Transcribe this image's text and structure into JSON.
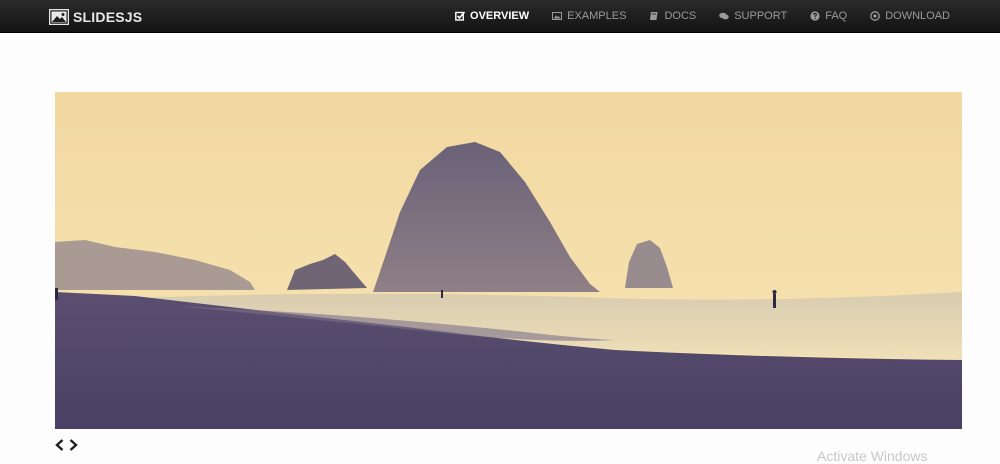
{
  "brand": {
    "name": "SLIDESJS",
    "icon": "image-icon"
  },
  "nav": {
    "items": [
      {
        "label": "OVERVIEW",
        "icon": "check-square-icon",
        "active": true
      },
      {
        "label": "EXAMPLES",
        "icon": "picture-icon",
        "active": false
      },
      {
        "label": "DOCS",
        "icon": "book-icon",
        "active": false
      },
      {
        "label": "SUPPORT",
        "icon": "comments-icon",
        "active": false
      },
      {
        "label": "FAQ",
        "icon": "question-circle-icon",
        "active": false
      },
      {
        "label": "DOWNLOAD",
        "icon": "download-circle-icon",
        "active": false
      }
    ]
  },
  "slideshow": {
    "pagination": {
      "prev_icon": "chevron-left-icon",
      "next_icon": "chevron-right-icon"
    }
  },
  "watermark": {
    "text": "Activate Windows"
  },
  "colors": {
    "topbar": "#1a1a1a",
    "nav_active": "#ffffff",
    "nav_inactive": "#9a9a9a",
    "sky": "#f3dca4",
    "sand": "#4e4466"
  }
}
